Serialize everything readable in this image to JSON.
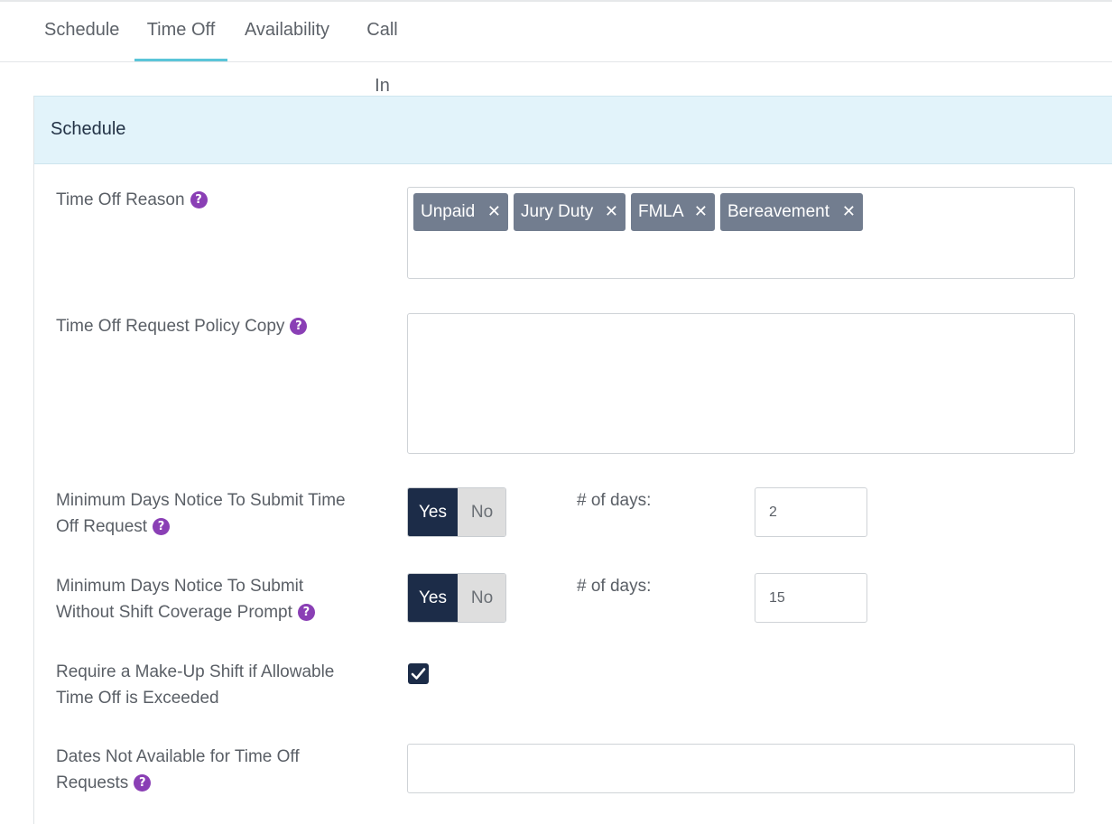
{
  "tabs": [
    {
      "label": "Schedule",
      "active": false
    },
    {
      "label": "Time Off",
      "active": true
    },
    {
      "label": "Availability",
      "active": false
    },
    {
      "label": "Call In",
      "active": false
    }
  ],
  "section": {
    "title": "Schedule"
  },
  "time_off_reason": {
    "label": "Time Off Reason",
    "help_icon": "question-circle-icon",
    "tags": [
      "Unpaid",
      "Jury Duty",
      "FMLA",
      "Bereavement"
    ],
    "remove_glyph": "✕"
  },
  "policy_copy": {
    "label": "Time Off Request Policy Copy",
    "value": ""
  },
  "min_notice_submit": {
    "label": "Minimum Days Notice To Submit Time Off Request",
    "yes_label": "Yes",
    "no_label": "No",
    "selected": "Yes",
    "days_label": "# of days:",
    "days_value": "2"
  },
  "min_notice_coverage": {
    "label": "Minimum Days Notice To Submit Without Shift Coverage Prompt",
    "yes_label": "Yes",
    "no_label": "No",
    "selected": "Yes",
    "days_label": "# of days:",
    "days_value": "15"
  },
  "makeup_shift": {
    "label": "Require a Make-Up Shift if Allowable Time Off is Exceeded",
    "checked": true
  },
  "dates_unavailable": {
    "label": "Dates Not Available for Time Off Requests",
    "value": ""
  },
  "colors": {
    "accent": "#5bc5d9",
    "toggle_active": "#1c2c48",
    "tag_bg": "#727d8f",
    "help_icon": "#8a3fb5",
    "header_bg": "#e2f3fa"
  }
}
